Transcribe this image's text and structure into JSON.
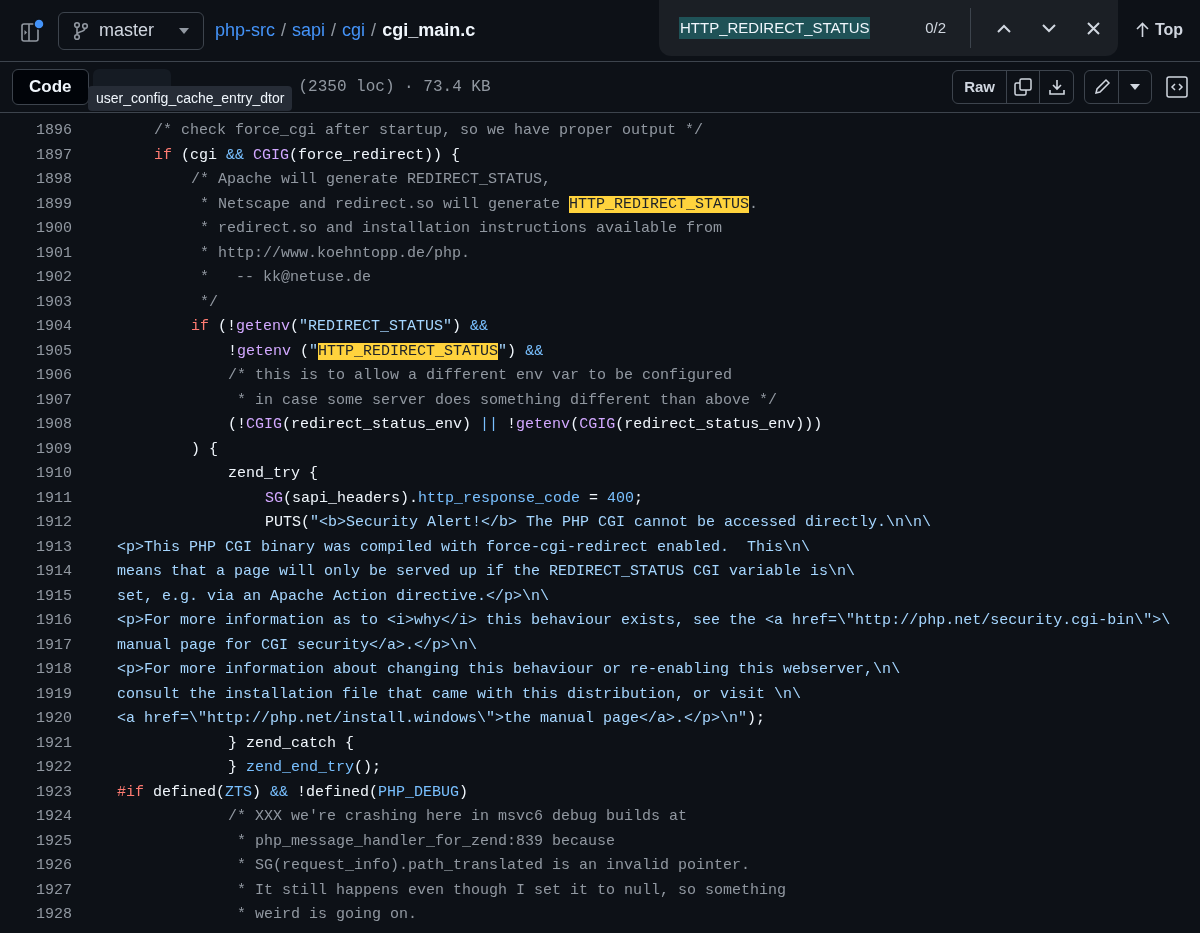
{
  "header": {
    "branch": "master",
    "breadcrumb": [
      {
        "kind": "link",
        "text": "php-src"
      },
      {
        "kind": "separator",
        "text": "/"
      },
      {
        "kind": "link",
        "text": "sapi"
      },
      {
        "kind": "separator",
        "text": "/"
      },
      {
        "kind": "link",
        "text": "cgi"
      },
      {
        "kind": "separator",
        "text": "/"
      },
      {
        "kind": "current",
        "text": "cgi_main.c"
      }
    ],
    "top_button": "Top"
  },
  "find": {
    "query": "HTTP_REDIRECT_STATUS",
    "count": "0/2"
  },
  "toolbar": {
    "tabs": [
      {
        "label": "Code",
        "selected": true
      },
      {
        "selected": false
      }
    ],
    "file_info": "(2350 loc) · 73.4 KB",
    "raw_button": "Raw"
  },
  "tooltip": "user_config_cache_entry_dtor",
  "code": [
    {
      "n": "1896",
      "tokens": [
        {
          "kind": "comment",
          "text": "\t/* check force_cgi after startup, so we have proper output */"
        }
      ]
    },
    {
      "n": "1897",
      "tokens": [
        {
          "kind": "keyword",
          "text": "\tif"
        },
        {
          "kind": "plain",
          "text": " (cgi "
        },
        {
          "kind": "constant",
          "text": "&&"
        },
        {
          "kind": "function",
          "text": " CGIG"
        },
        {
          "kind": "plain",
          "text": "(force_redirect)) {"
        }
      ]
    },
    {
      "n": "1898",
      "tokens": [
        {
          "kind": "comment",
          "text": "\t\t/* Apache will generate REDIRECT_STATUS,"
        }
      ]
    },
    {
      "n": "1899",
      "tokens": [
        {
          "kind": "comment",
          "text": "\t\t * Netscape and redirect.so will generate "
        },
        {
          "kind": "match",
          "text": "HTTP_REDIRECT_STATUS"
        },
        {
          "kind": "comment",
          "text": "."
        }
      ]
    },
    {
      "n": "1900",
      "tokens": [
        {
          "kind": "comment",
          "text": "\t\t * redirect.so and installation instructions available from"
        }
      ]
    },
    {
      "n": "1901",
      "tokens": [
        {
          "kind": "comment",
          "text": "\t\t * http://www.koehntopp.de/php."
        }
      ]
    },
    {
      "n": "1902",
      "tokens": [
        {
          "kind": "comment",
          "text": "\t\t *   -- kk@netuse.de"
        }
      ]
    },
    {
      "n": "1903",
      "tokens": [
        {
          "kind": "comment",
          "text": "\t\t */"
        }
      ]
    },
    {
      "n": "1904",
      "tokens": [
        {
          "kind": "keyword",
          "text": "\t\tif"
        },
        {
          "kind": "plain",
          "text": " (!"
        },
        {
          "kind": "function",
          "text": "getenv"
        },
        {
          "kind": "plain",
          "text": "("
        },
        {
          "kind": "string",
          "text": "\"REDIRECT_STATUS\""
        },
        {
          "kind": "plain",
          "text": ") "
        },
        {
          "kind": "constant",
          "text": "&&"
        }
      ]
    },
    {
      "n": "1905",
      "tokens": [
        {
          "kind": "plain",
          "text": "\t\t\t!"
        },
        {
          "kind": "function",
          "text": "getenv"
        },
        {
          "kind": "plain",
          "text": " ("
        },
        {
          "kind": "string",
          "text": "\""
        },
        {
          "kind": "match",
          "text": "HTTP_REDIRECT_STATUS"
        },
        {
          "kind": "string",
          "text": "\""
        },
        {
          "kind": "plain",
          "text": ") "
        },
        {
          "kind": "constant",
          "text": "&&"
        }
      ]
    },
    {
      "n": "1906",
      "tokens": [
        {
          "kind": "comment",
          "text": "\t\t\t/* this is to allow a different env var to be configured"
        }
      ]
    },
    {
      "n": "1907",
      "tokens": [
        {
          "kind": "comment",
          "text": "\t\t\t * in case some server does something different than above */"
        }
      ]
    },
    {
      "n": "1908",
      "tokens": [
        {
          "kind": "plain",
          "text": "\t\t\t(!"
        },
        {
          "kind": "function",
          "text": "CGIG"
        },
        {
          "kind": "plain",
          "text": "(redirect_status_env) "
        },
        {
          "kind": "constant",
          "text": "||"
        },
        {
          "kind": "plain",
          "text": " !"
        },
        {
          "kind": "function",
          "text": "getenv"
        },
        {
          "kind": "plain",
          "text": "("
        },
        {
          "kind": "function",
          "text": "CGIG"
        },
        {
          "kind": "plain",
          "text": "(redirect_status_env)))"
        }
      ]
    },
    {
      "n": "1909",
      "tokens": [
        {
          "kind": "plain",
          "text": "\t\t) {"
        }
      ]
    },
    {
      "n": "1910",
      "tokens": [
        {
          "kind": "plain",
          "text": "\t\t\tzend_try {"
        }
      ]
    },
    {
      "n": "1911",
      "tokens": [
        {
          "kind": "function",
          "text": "\t\t\t\tSG"
        },
        {
          "kind": "plain",
          "text": "(sapi_headers)."
        },
        {
          "kind": "constant",
          "text": "http_response_code"
        },
        {
          "kind": "plain",
          "text": " = "
        },
        {
          "kind": "constant",
          "text": "400"
        },
        {
          "kind": "plain",
          "text": ";"
        }
      ]
    },
    {
      "n": "1912",
      "tokens": [
        {
          "kind": "plain",
          "text": "\t\t\t\tPUTS("
        },
        {
          "kind": "string",
          "text": "\"<b>Security Alert!</b> The PHP CGI cannot be accessed directly.\\n\\n\\"
        }
      ]
    },
    {
      "n": "1913",
      "tokens": [
        {
          "kind": "string",
          "text": "<p>This PHP CGI binary was compiled with force-cgi-redirect enabled.  This\\n\\"
        }
      ]
    },
    {
      "n": "1914",
      "tokens": [
        {
          "kind": "string",
          "text": "means that a page will only be served up if the REDIRECT_STATUS CGI variable is\\n\\"
        }
      ]
    },
    {
      "n": "1915",
      "tokens": [
        {
          "kind": "string",
          "text": "set, e.g. via an Apache Action directive.</p>\\n\\"
        }
      ]
    },
    {
      "n": "1916",
      "tokens": [
        {
          "kind": "string",
          "text": "<p>For more information as to <i>why</i> this behaviour exists, see the <a href=\\\"http://php.net/security.cgi-bin\\\">\\"
        }
      ]
    },
    {
      "n": "1917",
      "tokens": [
        {
          "kind": "string",
          "text": "manual page for CGI security</a>.</p>\\n\\"
        }
      ]
    },
    {
      "n": "1918",
      "tokens": [
        {
          "kind": "string",
          "text": "<p>For more information about changing this behaviour or re-enabling this webserver,\\n\\"
        }
      ]
    },
    {
      "n": "1919",
      "tokens": [
        {
          "kind": "string",
          "text": "consult the installation file that came with this distribution, or visit \\n\\"
        }
      ]
    },
    {
      "n": "1920",
      "tokens": [
        {
          "kind": "string",
          "text": "<a href=\\\"http://php.net/install.windows\\\">the manual page</a>.</p>\\n\""
        },
        {
          "kind": "plain",
          "text": ");"
        }
      ]
    },
    {
      "n": "1921",
      "tokens": [
        {
          "kind": "plain",
          "text": "\t\t\t} zend_catch {"
        }
      ]
    },
    {
      "n": "1922",
      "tokens": [
        {
          "kind": "plain",
          "text": "\t\t\t} "
        },
        {
          "kind": "constant",
          "text": "zend_end_try"
        },
        {
          "kind": "plain",
          "text": "();"
        }
      ]
    },
    {
      "n": "1923",
      "tokens": [
        {
          "kind": "keyword",
          "text": "#if"
        },
        {
          "kind": "plain",
          "text": " defined("
        },
        {
          "kind": "constant",
          "text": "ZTS"
        },
        {
          "kind": "plain",
          "text": ") "
        },
        {
          "kind": "constant",
          "text": "&&"
        },
        {
          "kind": "plain",
          "text": " !defined("
        },
        {
          "kind": "constant",
          "text": "PHP_DEBUG"
        },
        {
          "kind": "plain",
          "text": ")"
        }
      ]
    },
    {
      "n": "1924",
      "tokens": [
        {
          "kind": "comment",
          "text": "\t\t\t/* XXX we're crashing here in msvc6 debug builds at"
        }
      ]
    },
    {
      "n": "1925",
      "tokens": [
        {
          "kind": "comment",
          "text": "\t\t\t * php_message_handler_for_zend:839 because"
        }
      ]
    },
    {
      "n": "1926",
      "tokens": [
        {
          "kind": "comment",
          "text": "\t\t\t * SG(request_info).path_translated is an invalid pointer."
        }
      ]
    },
    {
      "n": "1927",
      "tokens": [
        {
          "kind": "comment",
          "text": "\t\t\t * It still happens even though I set it to null, so something"
        }
      ]
    },
    {
      "n": "1928",
      "tokens": [
        {
          "kind": "comment",
          "text": "\t\t\t * weird is going on."
        }
      ]
    }
  ]
}
